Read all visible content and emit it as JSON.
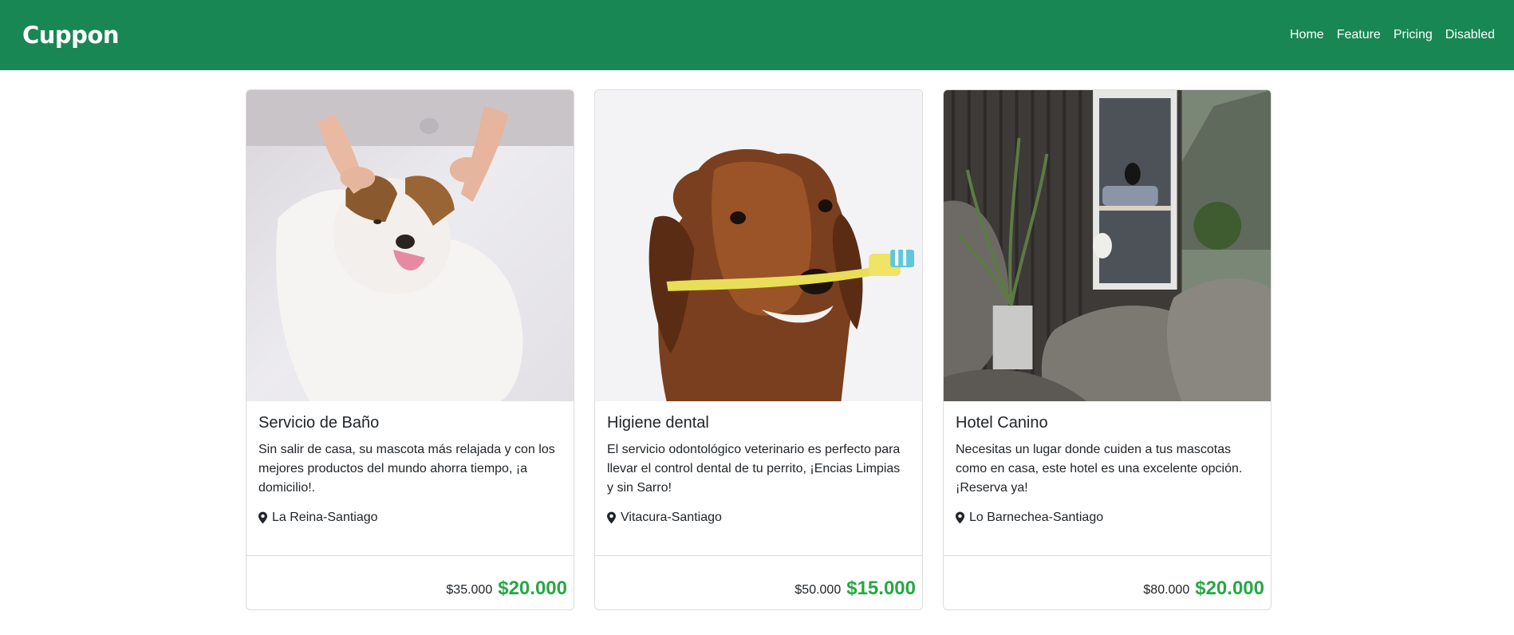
{
  "navbar": {
    "brand": "Cuppon",
    "links": [
      {
        "label": "Home"
      },
      {
        "label": "Feature"
      },
      {
        "label": "Pricing"
      },
      {
        "label": "Disabled"
      }
    ]
  },
  "cards": [
    {
      "image": "dog-bath-photo",
      "title": "Servicio de Baño",
      "text": "Sin salir de casa, su mascota más relajada y con los mejores productos del mundo ahorra tiempo, ¡a domicilio!.",
      "location": "La Reina-Santiago",
      "old_price": "$35.000",
      "new_price": "$20.000"
    },
    {
      "image": "dog-toothbrush-photo",
      "title": "Higiene dental",
      "text": "El servicio odontológico veterinario es perfecto para llevar el control dental de tu perrito, ¡Encias Limpias y sin Sarro!",
      "location": "Vitacura-Santiago",
      "old_price": "$50.000",
      "new_price": "$15.000"
    },
    {
      "image": "dog-hotel-photo",
      "title": "Hotel Canino",
      "text": "Necesitas un lugar donde cuiden a tus mascotas como en casa, este hotel es una excelente opción. ¡Reserva ya!",
      "location": "Lo Barnechea-Santiago",
      "old_price": "$80.000",
      "new_price": "$20.000"
    }
  ],
  "colors": {
    "navbar": "#198754",
    "price": "#28a745"
  }
}
